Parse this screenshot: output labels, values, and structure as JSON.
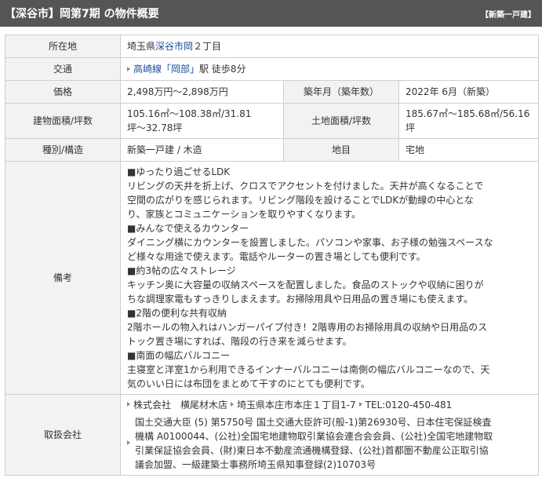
{
  "header": {
    "title": "【深谷市】岡第7期 の物件概要",
    "badge": "【新築一戸建】"
  },
  "table": {
    "address": {
      "label": "所在地",
      "prefix": "埼玉県",
      "link": "深谷市岡",
      "suffix": "２丁目"
    },
    "transport": {
      "label": "交通",
      "line": "高崎線",
      "station": "「岡部」",
      "rest": "駅 徒歩8分"
    },
    "price": {
      "label": "価格",
      "value": "2,498万円～2,898万円"
    },
    "built": {
      "label": "築年月（築年数）",
      "value": "2022年 6月（新築）"
    },
    "building_area": {
      "label": "建物面積/坪数",
      "line1": "105.16㎡～108.38㎡/31.81",
      "line2": "坪～32.78坪"
    },
    "land_area": {
      "label": "土地面積/坪数",
      "value": "185.67㎡～185.68㎡/56.16坪"
    },
    "type": {
      "label": "種別/構造",
      "value": "新築一戸建 / 木造"
    },
    "land_category": {
      "label": "地目",
      "value": "宅地"
    },
    "remarks": {
      "label": "備考",
      "lines": [
        "■ゆったり過ごせるLDK",
        "リビングの天井を折上げ、クロスでアクセントを付けました。天井が高くなることで",
        "空間の広がりを感じられます。リビング階段を設けることでLDKが動線の中心とな",
        "り、家族とコミュニケーションを取りやすくなります。",
        "■みんなで使えるカウンター",
        "ダイニング横にカウンターを設置しました。パソコンや家事、お子様の勉強スペースな",
        "ど様々な用途で使えます。電話やルーターの置き場としても便利です。",
        "■約3帖の広々ストレージ",
        "キッチン奥に大容量の収納スペースを配置しました。食品のストックや収納に困りが",
        "ちな調理家電もすっきりしまえます。お掃除用具や日用品の置き場にも使えます。",
        "■2階の便利な共有収納",
        "2階ホールの物入れはハンガーパイプ付き！2階専用のお掃除用具の収納や日用品のス",
        "トック置き場にすれば、階段の行き来を減らせます。",
        "■南面の幅広バルコニー",
        "主寝室と洋室1から利用できるインナーバルコニーは南側の幅広バルコニーなので、天",
        "気のいい日には布団をまとめて干すのにとても便利です。"
      ]
    },
    "agent": {
      "label": "取扱会社",
      "company": "株式会社　横尾材木店",
      "address": "埼玉県本庄市本庄１丁目1-7",
      "tel": "TEL:0120-450-481",
      "license_lines": [
        "国土交通大臣 (5) 第5750号 国土交通大臣許可(般-1)第26930号、日本住宅保証検査",
        "機構 A0100044、(公社)全国宅地建物取引業協会連合会会員、(公社)全国宅地建物取",
        "引業保証協会会員、(財)東日本不動産流通機構登録、(公社)首都圏不動産公正取引協",
        "議会加盟、一級建築士事務所埼玉県知事登録(2)10703号"
      ]
    }
  },
  "colors": {
    "header_bg": "#555555",
    "label_bg": "#f2f2f2",
    "link": "#1a4f9c",
    "border": "#cfcfcf"
  }
}
